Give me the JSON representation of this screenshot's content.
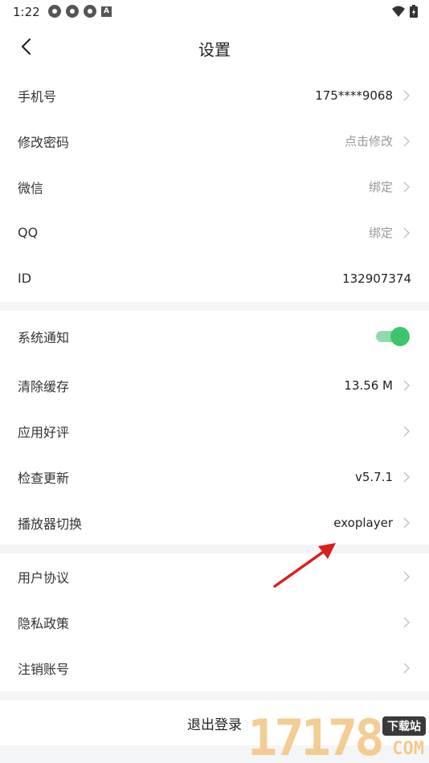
{
  "status_bar": {
    "time": "1:22",
    "a_icon": "A"
  },
  "header": {
    "title": "设置"
  },
  "group1": [
    {
      "label": "手机号",
      "value": "175****9068",
      "muted": false,
      "chevron": true
    },
    {
      "label": "修改密码",
      "value": "点击修改",
      "muted": true,
      "chevron": true
    },
    {
      "label": "微信",
      "value": "绑定",
      "muted": true,
      "chevron": true
    },
    {
      "label": "QQ",
      "value": "绑定",
      "muted": true,
      "chevron": true
    },
    {
      "label": "ID",
      "value": "132907374",
      "muted": false,
      "chevron": false
    }
  ],
  "group2": [
    {
      "label": "系统通知",
      "toggle_on": true
    },
    {
      "label": "清除缓存",
      "value": "13.56 M"
    },
    {
      "label": "应用好评",
      "value": ""
    },
    {
      "label": "检查更新",
      "value": "v5.7.1"
    },
    {
      "label": "播放器切换",
      "value": "exoplayer"
    }
  ],
  "group3": [
    {
      "label": "用户协议"
    },
    {
      "label": "隐私政策"
    },
    {
      "label": "注销账号"
    }
  ],
  "logout": {
    "label": "退出登录"
  },
  "watermark": {
    "number": "17178",
    "badge": "下载站",
    "suffix": "COM"
  },
  "colors": {
    "toggle_on": "#3ec56b",
    "toggle_track": "#8fdcaa",
    "arrow": "#d9201c",
    "background": "#f4f5f7"
  }
}
